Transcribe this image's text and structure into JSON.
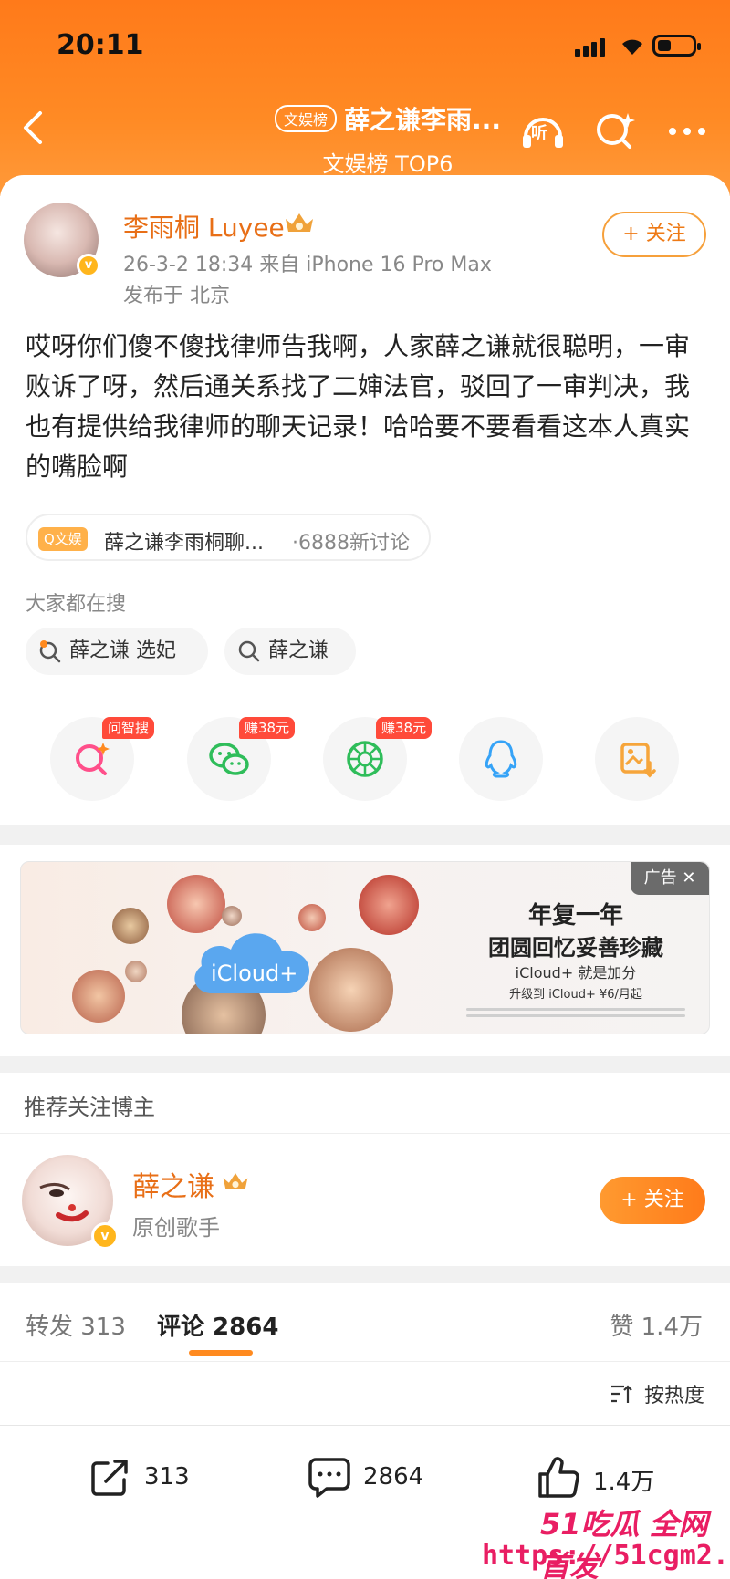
{
  "status_bar": {
    "time": "20:11"
  },
  "header": {
    "tag": "文娱榜",
    "title": "薛之谦李雨...",
    "subtitle": "文娱榜 TOP6",
    "listen_label": "听"
  },
  "post": {
    "author": "李雨桐 Luyee",
    "meta": "26-3-2 18:34  来自 iPhone 16 Pro Max",
    "location": "发布于 北京",
    "follow_label": "+ 关注",
    "body": "哎呀你们傻不傻找律师告我啊，人家薛之谦就很聪明，一审败诉了呀，然后通关系找了二婶法官，驳回了一审判决，我也有提供给我律师的聊天记录！哈哈要不要看看这本人真实的嘴脸啊",
    "topic": {
      "tag": "Q文娱",
      "name": "薛之谦李雨桐聊...",
      "count": "·6888新讨论"
    },
    "search_label": "大家都在搜",
    "search_chips": [
      "薛之谦 选妃",
      "薛之谦"
    ]
  },
  "share_badges": [
    "问智搜",
    "赚38元",
    "赚38元"
  ],
  "share_icons": [
    "sparkle-search-icon",
    "wechat-icon",
    "moments-icon",
    "qq-icon",
    "save-image-icon"
  ],
  "ad": {
    "tag": "广告 ✕",
    "cloud_label": "iCloud+",
    "headline1": "年复一年",
    "headline2": "团圆回忆妥善珍藏",
    "line3": "iCloud+ 就是加分",
    "line4": "升级到 iCloud+ ¥6/月起"
  },
  "recommend": {
    "title": "推荐关注博主",
    "name": "薛之谦",
    "desc": "原创歌手",
    "follow_label": "+ 关注"
  },
  "tabs": {
    "repost": "转发 313",
    "comment": "评论 2864",
    "like": "赞 1.4万",
    "sort": "按热度"
  },
  "bottom_bar": {
    "repost": "313",
    "comment": "2864",
    "like": "1.4万"
  },
  "watermark": {
    "line1": "51吃瓜 全网首发",
    "line2": "https://51cgm2.com"
  },
  "colors": {
    "accent": "#ff7a1a",
    "name": "#e86f17",
    "badge": "#ff4a3a"
  }
}
